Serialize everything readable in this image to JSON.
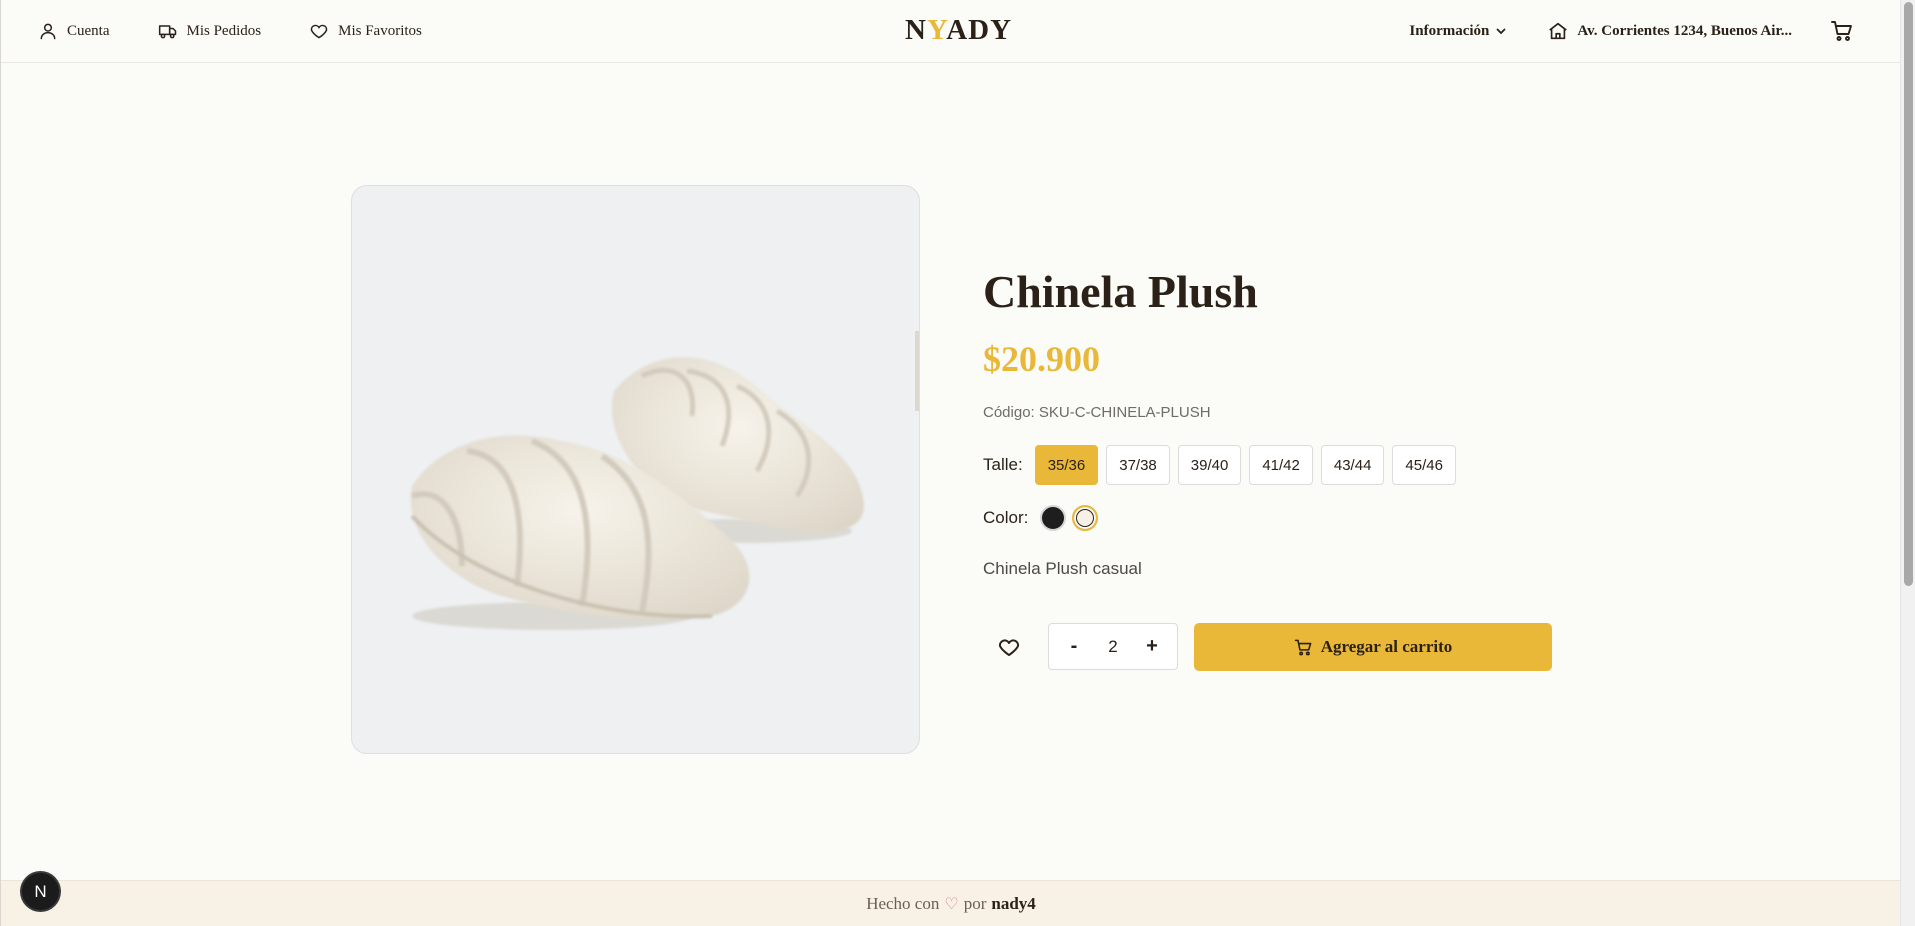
{
  "header": {
    "nav_left": [
      {
        "label": "Cuenta",
        "icon": "user-icon"
      },
      {
        "label": "Mis Pedidos",
        "icon": "truck-icon"
      },
      {
        "label": "Mis Favoritos",
        "icon": "heart-icon"
      }
    ],
    "logo": {
      "part1": "N",
      "part2": "Y",
      "part3": "ADY"
    },
    "info_label": "Información",
    "address": "Av. Corrientes 1234, Buenos Air...",
    "cart_icon": "cart-icon"
  },
  "product": {
    "title": "Chinela Plush",
    "price": "$20.900",
    "sku": "Código: SKU-C-CHINELA-PLUSH",
    "size_label": "Talle:",
    "sizes": [
      "35/36",
      "37/38",
      "39/40",
      "41/42",
      "43/44",
      "45/46"
    ],
    "selected_size": "35/36",
    "color_label": "Color:",
    "colors": [
      {
        "name": "black",
        "hex": "#1e1e1e"
      },
      {
        "name": "cream",
        "hex": "#f6f1e4"
      }
    ],
    "selected_color": "cream",
    "description": "Chinela Plush casual",
    "quantity": "2",
    "minus_label": "-",
    "plus_label": "+",
    "add_to_cart_label": "Agregar al carrito"
  },
  "footer": {
    "prefix": "Hecho con",
    "heart": "♡",
    "middle": "por",
    "author": "nady4"
  },
  "badge": {
    "letter": "N"
  },
  "colors": {
    "accent": "#e9b839",
    "text": "#2b2118",
    "background": "#fbfbf7"
  }
}
